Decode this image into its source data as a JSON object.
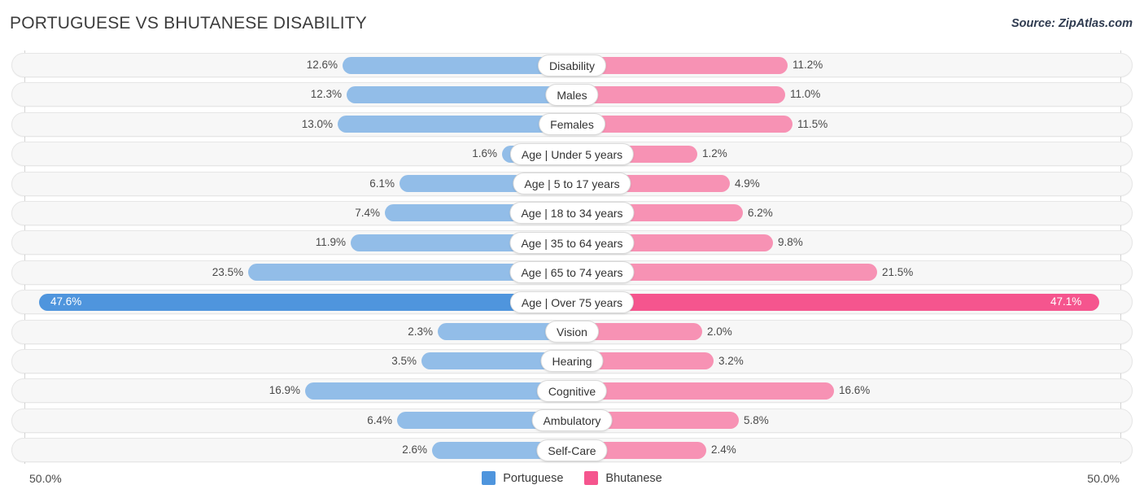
{
  "header": {
    "title": "PORTUGUESE VS BHUTANESE DISABILITY",
    "source": "Source: ZipAtlas.com"
  },
  "footer": {
    "axis_left": "50.0%",
    "axis_right": "50.0%",
    "legend": [
      {
        "label": "Portuguese",
        "color": "#4f95dd"
      },
      {
        "label": "Bhutanese",
        "color": "#f5558e"
      }
    ]
  },
  "colors": {
    "left_bar": "#92bde8",
    "right_bar": "#f792b4",
    "left_bar_highlight": "#4f95dd",
    "right_bar_highlight": "#f5558e",
    "track": "#f7f7f7",
    "gridline": "#d4d4d4"
  },
  "chart_data": {
    "type": "bar",
    "title": "PORTUGUESE VS BHUTANESE DISABILITY",
    "subtitle": "Source: ZipAtlas.com",
    "orientation": "horizontal-diverging",
    "xlabel": "",
    "ylabel": "",
    "xlim": [
      50.0,
      50.0
    ],
    "axis_left_label": "50.0%",
    "axis_right_label": "50.0%",
    "grid": true,
    "legend_position": "bottom-center",
    "categories": [
      "Disability",
      "Males",
      "Females",
      "Age | Under 5 years",
      "Age | 5 to 17 years",
      "Age | 18 to 34 years",
      "Age | 35 to 64 years",
      "Age | 65 to 74 years",
      "Age | Over 75 years",
      "Vision",
      "Hearing",
      "Cognitive",
      "Ambulatory",
      "Self-Care"
    ],
    "series": [
      {
        "name": "Portuguese",
        "side": "left",
        "color": "#92bde8",
        "values": [
          12.6,
          12.3,
          13.0,
          1.6,
          6.1,
          7.4,
          11.9,
          23.5,
          47.6,
          2.3,
          3.5,
          16.9,
          6.4,
          2.6
        ],
        "labels": [
          "12.6%",
          "12.3%",
          "13.0%",
          "1.6%",
          "6.1%",
          "7.4%",
          "11.9%",
          "23.5%",
          "47.6%",
          "2.3%",
          "3.5%",
          "16.9%",
          "6.4%",
          "2.6%"
        ]
      },
      {
        "name": "Bhutanese",
        "side": "right",
        "color": "#f792b4",
        "values": [
          11.2,
          11.0,
          11.5,
          1.2,
          4.9,
          6.2,
          9.8,
          21.5,
          47.1,
          2.0,
          3.2,
          16.6,
          5.8,
          2.4
        ],
        "labels": [
          "11.2%",
          "11.0%",
          "11.5%",
          "1.2%",
          "4.9%",
          "6.2%",
          "9.8%",
          "21.5%",
          "47.1%",
          "2.0%",
          "3.2%",
          "16.6%",
          "5.8%",
          "2.4%"
        ]
      }
    ],
    "highlight_row_index": 8
  },
  "rows": [
    {
      "category": "Disability",
      "left_label": "12.6%",
      "right_label": "11.2%",
      "left_w": 282,
      "right_w": 265,
      "highlight": false
    },
    {
      "category": "Males",
      "left_label": "12.3%",
      "right_label": "11.0%",
      "left_w": 277,
      "right_w": 262,
      "highlight": false
    },
    {
      "category": "Females",
      "left_label": "13.0%",
      "right_label": "11.5%",
      "left_w": 288,
      "right_w": 271,
      "highlight": false
    },
    {
      "category": "Age | Under 5 years",
      "left_label": "1.6%",
      "right_label": "1.2%",
      "left_w": 86,
      "right_w": 154,
      "highlight": false
    },
    {
      "category": "Age | 5 to 17 years",
      "left_label": "6.1%",
      "right_label": "4.9%",
      "left_w": 212,
      "right_w": 194,
      "highlight": false
    },
    {
      "category": "Age | 18 to 34 years",
      "left_label": "7.4%",
      "right_label": "6.2%",
      "left_w": 230,
      "right_w": 210,
      "highlight": false
    },
    {
      "category": "Age | 35 to 64 years",
      "left_label": "11.9%",
      "right_label": "9.8%",
      "left_w": 272,
      "right_w": 247,
      "highlight": false
    },
    {
      "category": "Age | 65 to 74 years",
      "left_label": "23.5%",
      "right_label": "21.5%",
      "left_w": 398,
      "right_w": 375,
      "highlight": false
    },
    {
      "category": "Age | Over 75 years",
      "left_label": "47.6%",
      "right_label": "47.1%",
      "left_w": 655,
      "right_w": 648,
      "highlight": true
    },
    {
      "category": "Vision",
      "left_label": "2.3%",
      "right_label": "2.0%",
      "left_w": 165,
      "right_w": 160,
      "highlight": false
    },
    {
      "category": "Hearing",
      "left_label": "3.5%",
      "right_label": "3.2%",
      "left_w": 185,
      "right_w": 174,
      "highlight": false
    },
    {
      "category": "Cognitive",
      "left_label": "16.9%",
      "right_label": "16.6%",
      "left_w": 328,
      "right_w": 322,
      "highlight": false
    },
    {
      "category": "Ambulatory",
      "left_label": "6.4%",
      "right_label": "5.8%",
      "left_w": 215,
      "right_w": 205,
      "highlight": false
    },
    {
      "category": "Self-Care",
      "left_label": "2.6%",
      "right_label": "2.4%",
      "left_w": 172,
      "right_w": 165,
      "highlight": false
    }
  ]
}
